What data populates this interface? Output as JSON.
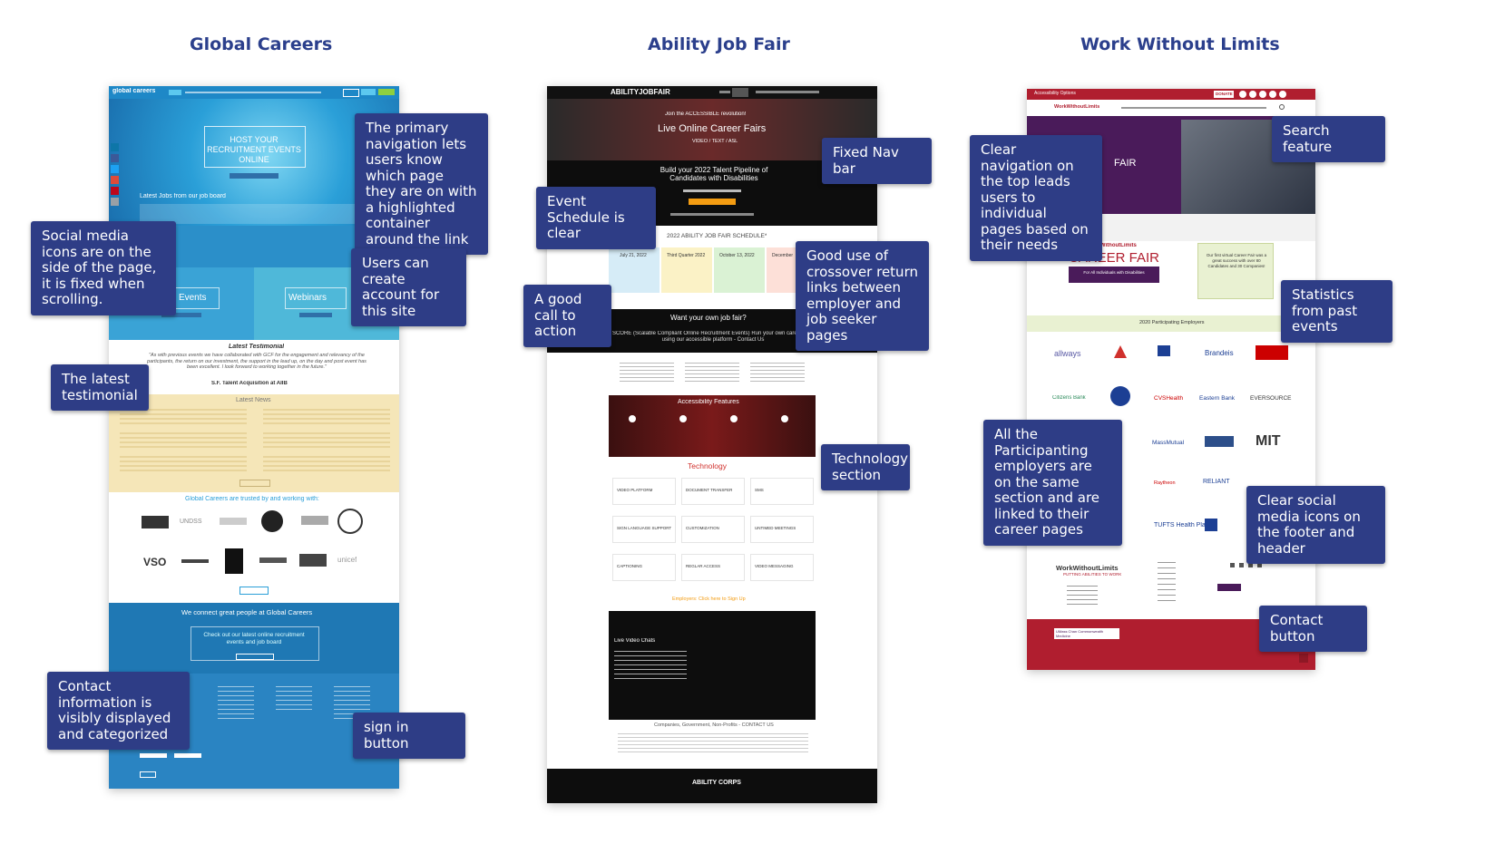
{
  "titles": {
    "global": "Global Careers",
    "ability": "Ability Job Fair",
    "wwl": "Work Without Limits"
  },
  "global_careers": {
    "brand": "global careers",
    "hero": "HOST YOUR RECRUITMENT EVENTS ONLINE",
    "latest_jobs": "Latest Jobs from our job board",
    "virtual_events": "Virtual Events",
    "webinars": "Webinars",
    "latest_testimonial": "Latest Testimonial",
    "testimonial_quote": "\"As with previous events we have collaborated with GCF for the engagement and relevancy of the participants, the return on our investment, the support in the lead up, on the day and post event has been excellent. I look forward to working together in the future.\"",
    "testimonial_author": "S.F. Talent Acquisition at AIIB",
    "latest_news": "Latest News",
    "trusted": "Global Careers are trusted by and working with:",
    "connect": "We connect great people at Global Careers",
    "check_out": "Check out our latest online recruitment events and job board",
    "partners": [
      "UNDSS",
      "EUROCONTROL",
      "IOM",
      "VSO",
      "unicef"
    ],
    "social_colors": [
      "#0e76a8",
      "#3b5998",
      "#1da1f2",
      "#dd4b39",
      "#bd081c",
      "#9aa0a6"
    ]
  },
  "ability_job_fair": {
    "brand": "ABILITYJOBFAIR",
    "tagline": "Join the ACCESSIBLE revolution!",
    "hero": "Live Online Career Fairs",
    "hero_sub": "VIDEO / TEXT / ASL",
    "pipeline": "Build your 2022 Talent Pipeline of Candidates with Disabilities",
    "schedule": "2022 ABILITY JOB FAIR SCHEDULE*",
    "dates": [
      "July 21, 2022",
      "Third Quarter 2022",
      "October 13, 2022",
      "December"
    ],
    "own_fair": "Want your own job fair?",
    "score": "SCORE (Scalable Compliant Online Recruitment Events) Run your own career fairs using our accessible platform - Contact Us",
    "accessibility": "Accessibility Features",
    "technology": "Technology",
    "tech_items": [
      "VIDEO PLATFORM",
      "DOCUMENT TRANSFER",
      "SMS",
      "SIGN LANGUAGE SUPPORT",
      "CUSTOMIZATION",
      "UNTIMED MEETINGS",
      "CAPTIONING",
      "REGLAR ACCESS",
      "VIDEO MESSAGING"
    ],
    "employers_link": "Employers: Click here to Sign Up",
    "live_video": "Live Video Chats",
    "footer_line": "Companies, Government, Non-Profits - CONTACT US",
    "footer_brand": "ABILITY CORPS"
  },
  "work_without_limits": {
    "brand": "WorkWithoutLimits",
    "top_link": "Accessibility Options",
    "donate": "DONATE",
    "hero_fair": "FAIR",
    "career_fair": "CAREER FAIR",
    "for_all": "For All Individuals with Disabilities",
    "participating": "2020 Participating Employers",
    "stats_text": "Our first virtual Career Fair was a great success with over 80 Candidates and 30 Companies!",
    "logos": [
      "allways",
      "AMERICAN TOWER",
      "MASSACHUSETTS",
      "Brandeis",
      "BOSTON UNIVERSITY",
      "Citizens Bank",
      "CVSHealth",
      "Eastern Bank",
      "EVERSOURCE",
      "MassMutual",
      "Middlesex Savings Bank",
      "MIT",
      "Raytheon",
      "RELIANT",
      "SPAULDING",
      "TUFTS Health Plan",
      "State Street"
    ],
    "footer_brand": "WorkWithoutLimits",
    "footer_tag": "PUTTING ABILITIES TO WORK",
    "footer_org": "UMass Chan Commonwealth Medicine"
  },
  "callouts": {
    "primary_nav": "The primary navigation lets users know which page they are on with a highlighted container around the link",
    "social_side": "Social media icons are on the side of the page, it is fixed when scrolling.",
    "create_account": "Users can create account for this site",
    "latest_testimonial": "The latest testimonial",
    "contact_info": "Contact information is visibly displayed and categorized",
    "sign_in": "sign in button",
    "fixed_nav": "Fixed Nav bar",
    "event_schedule": "Event Schedule is clear",
    "good_cta": "A good call to action",
    "crossover": "Good use of crossover return links between employer and job seeker pages",
    "technology": "Technology section",
    "clear_nav": "Clear navigation on the top leads users to individual pages based on their needs",
    "search": "Search feature",
    "statistics": "Statistics from past events",
    "participants": "All the Participanting employers are on the same section and are linked to their career pages",
    "social_footer": "Clear social media icons on the footer and header",
    "contact_button": "Contact button"
  }
}
